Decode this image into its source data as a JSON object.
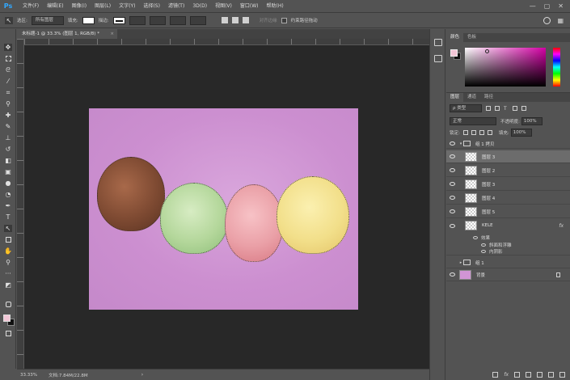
{
  "app": {
    "logo": "Ps"
  },
  "menu": [
    "文件(F)",
    "编辑(E)",
    "图像(I)",
    "图层(L)",
    "文字(Y)",
    "选择(S)",
    "滤镜(T)",
    "3D(D)",
    "视图(V)",
    "窗口(W)",
    "帮助(H)"
  ],
  "window_controls": {
    "minimize": "—",
    "maximize": "▢",
    "close": "✕"
  },
  "options": {
    "sample_label": "选区:",
    "sample_value": "所有图层",
    "fill_label": "填充:",
    "stroke_label": "描边:",
    "auto_align_label": "对齐边缘",
    "constrain_label": "约束路径拖动"
  },
  "document": {
    "tab_title": "未标题-1 @ 33.3% (图层 1, RGB/8) *",
    "tab_close": "×",
    "zoom": "33.33%",
    "doc_size": "文档:7.84M/22.8M",
    "status_arrow": "›"
  },
  "color_panel": {
    "tabs": [
      "颜色",
      "色板"
    ],
    "foreground": "#f2c6d6",
    "background": "#111111"
  },
  "layers_panel": {
    "tabs": [
      "图层",
      "通道",
      "路径"
    ],
    "filter_label": "ρ 类型",
    "blend_mode": "正常",
    "opacity_label": "不透明度:",
    "opacity_value": "100%",
    "lock_label": "锁定:",
    "fill_label": "填充:",
    "fill_value": "100%",
    "layers": {
      "group_copy": "组 1 拷贝",
      "layer3": "图层 3",
      "layer2": "图层 2",
      "layer3b": "图层 3",
      "layer4": "图层 4",
      "layer5": "图层 5",
      "text_layer": "KELE",
      "effects_label": "效果",
      "effect1": "斜面和浮雕",
      "effect2": "内阴影",
      "group1": "组 1",
      "background": "背景"
    },
    "fx_label": "fx"
  },
  "icons": [
    "move-icon",
    "marquee-icon",
    "lasso-icon",
    "magic-wand-icon",
    "crop-icon",
    "eyedropper-icon",
    "brush-icon",
    "stamp-icon",
    "eraser-icon",
    "gradient-icon",
    "pen-icon",
    "type-icon",
    "path-select-icon",
    "hand-icon",
    "zoom-icon",
    "eye-icon",
    "folder-icon",
    "lock-icon",
    "search-icon"
  ]
}
